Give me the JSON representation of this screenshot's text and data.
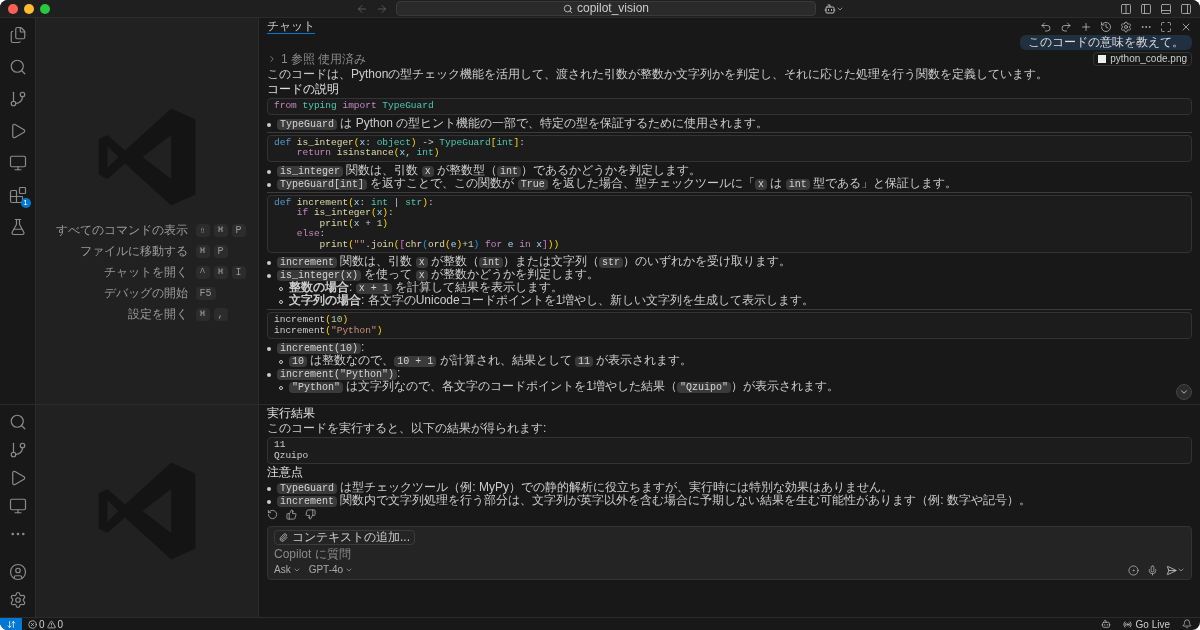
{
  "window": {
    "title": "copilot_vision"
  },
  "activity_bar": {
    "extensions_badge": "1"
  },
  "shortcuts": [
    {
      "label": "すべてのコマンドの表示",
      "keys": [
        "⇧",
        "⌘",
        "P"
      ]
    },
    {
      "label": "ファイルに移動する",
      "keys": [
        "⌘",
        "P"
      ]
    },
    {
      "label": "チャットを開く",
      "keys": [
        "^",
        "⌘",
        "I"
      ]
    },
    {
      "label": "デバッグの開始",
      "keys": [
        "F5"
      ]
    },
    {
      "label": "設定を開く",
      "keys": [
        "⌘",
        ","
      ]
    }
  ],
  "chat": {
    "tab": "チャット",
    "user_message": "このコードの意味を教えて。",
    "attachment": "python_code.png",
    "references": "1 参照 使用済み",
    "blocks": [
      {
        "kind": "paragraph",
        "text": "このコードは、Pythonの型チェック機能を活用して、渡された引数が整数か文字列かを判定し、それに応じた処理を行う関数を定義しています。"
      },
      {
        "kind": "heading",
        "text": "コードの説明"
      },
      {
        "kind": "code",
        "lines": [
          [
            {
              "text": "from",
              "kind": "ctl"
            },
            {
              "text": " typing",
              "kind": "type"
            },
            {
              "text": " import",
              "kind": "ctl"
            },
            {
              "text": " TypeGuard",
              "kind": "type"
            }
          ]
        ]
      },
      {
        "kind": "bullets",
        "items": [
          {
            "parts": [
              {
                "kind": "code",
                "text": "TypeGuard"
              },
              {
                "kind": "text",
                "text": " は Python の型ヒント機能の一部で、特定の型を保証するために使用されます。"
              }
            ]
          }
        ]
      },
      {
        "kind": "rule"
      },
      {
        "kind": "code",
        "lines": [
          [
            {
              "text": "def",
              "kind": "kw"
            },
            {
              "text": " is_integer",
              "kind": "fn"
            },
            {
              "text": "(",
              "kind": "br"
            },
            {
              "text": "x",
              "kind": "var"
            },
            {
              "text": ":",
              "kind": "p"
            },
            {
              "text": " object",
              "kind": "type"
            },
            {
              "text": ")",
              "kind": "br"
            },
            {
              "text": " ->",
              "kind": "p"
            },
            {
              "text": " TypeGuard",
              "kind": "type"
            },
            {
              "text": "[",
              "kind": "br"
            },
            {
              "text": "int",
              "kind": "type"
            },
            {
              "text": "]",
              "kind": "br"
            },
            {
              "text": ":",
              "kind": "p"
            }
          ],
          [
            {
              "text": "    return",
              "kind": "ctl"
            },
            {
              "text": " isinstance",
              "kind": "fn"
            },
            {
              "text": "(",
              "kind": "br"
            },
            {
              "text": "x",
              "kind": "var"
            },
            {
              "text": ",",
              "kind": "p"
            },
            {
              "text": " int",
              "kind": "type"
            },
            {
              "text": ")",
              "kind": "br"
            }
          ]
        ]
      },
      {
        "kind": "bullets",
        "items": [
          {
            "parts": [
              {
                "kind": "code",
                "text": "is_integer"
              },
              {
                "kind": "text",
                "text": " 関数は、引数 "
              },
              {
                "kind": "code",
                "text": "x"
              },
              {
                "kind": "text",
                "text": " が整数型（"
              },
              {
                "kind": "code",
                "text": "int"
              },
              {
                "kind": "text",
                "text": "）であるかどうかを判定します。"
              }
            ]
          },
          {
            "parts": [
              {
                "kind": "code",
                "text": "TypeGuard[int]"
              },
              {
                "kind": "text",
                "text": " を返すことで、この関数が "
              },
              {
                "kind": "code",
                "text": "True"
              },
              {
                "kind": "text",
                "text": " を返した場合、型チェックツールに「"
              },
              {
                "kind": "code",
                "text": "x"
              },
              {
                "kind": "text",
                "text": " は "
              },
              {
                "kind": "code",
                "text": "int"
              },
              {
                "kind": "text",
                "text": " 型である」と保証します。"
              }
            ]
          }
        ]
      },
      {
        "kind": "rule"
      },
      {
        "kind": "code",
        "lines": [
          [
            {
              "text": "def",
              "kind": "kw"
            },
            {
              "text": " increment",
              "kind": "fn"
            },
            {
              "text": "(",
              "kind": "br"
            },
            {
              "text": "x",
              "kind": "var"
            },
            {
              "text": ":",
              "kind": "p"
            },
            {
              "text": " int",
              "kind": "type"
            },
            {
              "text": " |",
              "kind": "p"
            },
            {
              "text": " str",
              "kind": "type"
            },
            {
              "text": ")",
              "kind": "br"
            },
            {
              "text": ":",
              "kind": "p"
            }
          ],
          [
            {
              "text": "    if",
              "kind": "ctl"
            },
            {
              "text": " is_integer",
              "kind": "fn"
            },
            {
              "text": "(",
              "kind": "br"
            },
            {
              "text": "x",
              "kind": "var"
            },
            {
              "text": ")",
              "kind": "br"
            },
            {
              "text": ":",
              "kind": "p"
            }
          ],
          [
            {
              "text": "        print",
              "kind": "fn"
            },
            {
              "text": "(",
              "kind": "br"
            },
            {
              "text": "x",
              "kind": "var"
            },
            {
              "text": " +",
              "kind": "p"
            },
            {
              "text": " 1",
              "kind": "num"
            },
            {
              "text": ")",
              "kind": "br"
            }
          ],
          [
            {
              "text": "    else",
              "kind": "ctl"
            },
            {
              "text": ":",
              "kind": "p"
            }
          ],
          [
            {
              "text": "        print",
              "kind": "fn"
            },
            {
              "text": "(",
              "kind": "br"
            },
            {
              "text": "\"\"",
              "kind": "str"
            },
            {
              "text": ".",
              "kind": "p"
            },
            {
              "text": "join",
              "kind": "fn"
            },
            {
              "text": "(",
              "kind": "br"
            },
            {
              "text": "[",
              "kind": "br2"
            },
            {
              "text": "chr",
              "kind": "fn"
            },
            {
              "text": "(",
              "kind": "br3"
            },
            {
              "text": "ord",
              "kind": "fn"
            },
            {
              "text": "(",
              "kind": "br"
            },
            {
              "text": "e",
              "kind": "var"
            },
            {
              "text": ")",
              "kind": "br"
            },
            {
              "text": "+",
              "kind": "p"
            },
            {
              "text": "1",
              "kind": "num"
            },
            {
              "text": ")",
              "kind": "br3"
            },
            {
              "text": " for",
              "kind": "ctl"
            },
            {
              "text": " e",
              "kind": "var"
            },
            {
              "text": " in",
              "kind": "ctl"
            },
            {
              "text": " x",
              "kind": "var"
            },
            {
              "text": "]",
              "kind": "br2"
            },
            {
              "text": ")",
              "kind": "br"
            },
            {
              "text": ")",
              "kind": "br"
            }
          ]
        ]
      },
      {
        "kind": "bullets",
        "items": [
          {
            "parts": [
              {
                "kind": "code",
                "text": "increment"
              },
              {
                "kind": "text",
                "text": " 関数は、引数 "
              },
              {
                "kind": "code",
                "text": "x"
              },
              {
                "kind": "text",
                "text": " が整数（"
              },
              {
                "kind": "code",
                "text": "int"
              },
              {
                "kind": "text",
                "text": "）または文字列（"
              },
              {
                "kind": "code",
                "text": "str"
              },
              {
                "kind": "text",
                "text": "）のいずれかを受け取ります。"
              }
            ]
          },
          {
            "parts": [
              {
                "kind": "code",
                "text": "is_integer(x)"
              },
              {
                "kind": "text",
                "text": " を使って "
              },
              {
                "kind": "code",
                "text": "x"
              },
              {
                "kind": "text",
                "text": " が整数かどうかを判定します。"
              }
            ],
            "children": [
              {
                "parts": [
                  {
                    "kind": "text",
                    "text": "**整数の場合**: "
                  },
                  {
                    "kind": "code",
                    "text": "x + 1"
                  },
                  {
                    "kind": "text",
                    "text": " を計算して結果を表示します。"
                  }
                ]
              },
              {
                "parts": [
                  {
                    "kind": "text",
                    "text": "**文字列の場合**: 各文字のUnicodeコードポイントを1増やし、新しい文字列を生成して表示します。"
                  }
                ]
              }
            ]
          }
        ]
      },
      {
        "kind": "rule"
      },
      {
        "kind": "code",
        "lines": [
          [
            {
              "text": "increment",
              "kind": "p"
            },
            {
              "text": "(",
              "kind": "br"
            },
            {
              "text": "10",
              "kind": "num"
            },
            {
              "text": ")",
              "kind": "br"
            }
          ],
          [
            {
              "text": "increment",
              "kind": "p"
            },
            {
              "text": "(",
              "kind": "br"
            },
            {
              "text": "\"Python\"",
              "kind": "str"
            },
            {
              "text": ")",
              "kind": "br"
            }
          ]
        ]
      },
      {
        "kind": "bullets",
        "items": [
          {
            "parts": [
              {
                "kind": "code",
                "text": "increment(10)"
              },
              {
                "kind": "text",
                "text": ":"
              }
            ],
            "children": [
              {
                "parts": [
                  {
                    "kind": "code",
                    "text": "10"
                  },
                  {
                    "kind": "text",
                    "text": " は整数なので、"
                  },
                  {
                    "kind": "code",
                    "text": "10 + 1"
                  },
                  {
                    "kind": "text",
                    "text": " が計算され、結果として "
                  },
                  {
                    "kind": "code",
                    "text": "11"
                  },
                  {
                    "kind": "text",
                    "text": " が表示されます。"
                  }
                ]
              }
            ]
          },
          {
            "parts": [
              {
                "kind": "code",
                "text": "increment(\"Python\")"
              },
              {
                "kind": "text",
                "text": ":"
              }
            ],
            "children": [
              {
                "parts": [
                  {
                    "kind": "code",
                    "text": "\"Python\""
                  },
                  {
                    "kind": "text",
                    "text": " は文字列なので、各文字のコードポイントを1増やした結果（"
                  },
                  {
                    "kind": "code",
                    "text": "\"Qzuipo\""
                  },
                  {
                    "kind": "text",
                    "text": "）が表示されます。"
                  }
                ]
              }
            ]
          }
        ]
      }
    ],
    "lower_blocks": [
      {
        "kind": "heading",
        "text": "実行結果"
      },
      {
        "kind": "paragraph",
        "text": "このコードを実行すると、以下の結果が得られます:"
      },
      {
        "kind": "code",
        "lines": [
          [
            {
              "text": "11",
              "kind": "p"
            }
          ],
          [
            {
              "text": "Qzuipo",
              "kind": "p"
            }
          ]
        ]
      },
      {
        "kind": "heading",
        "text": "注意点"
      },
      {
        "kind": "bullets",
        "items": [
          {
            "parts": [
              {
                "kind": "code",
                "text": "TypeGuard"
              },
              {
                "kind": "text",
                "text": " は型チェックツール（例: MyPy）での静的解析に役立ちますが、実行時には特別な効果はありません。"
              }
            ]
          },
          {
            "parts": [
              {
                "kind": "code",
                "text": "increment"
              },
              {
                "kind": "text",
                "text": " 関数内で文字列処理を行う部分は、文字列が英字以外を含む場合に予期しない結果を生む可能性があります（例: 数字や記号）。"
              }
            ]
          }
        ]
      }
    ],
    "input": {
      "context_button": "コンテキストの追加...",
      "placeholder": "Copilot に質問",
      "mode": "Ask",
      "model": "GPT-4o"
    }
  },
  "status_bar": {
    "errors": "0",
    "warnings": "0",
    "go_live": "Go Live"
  }
}
